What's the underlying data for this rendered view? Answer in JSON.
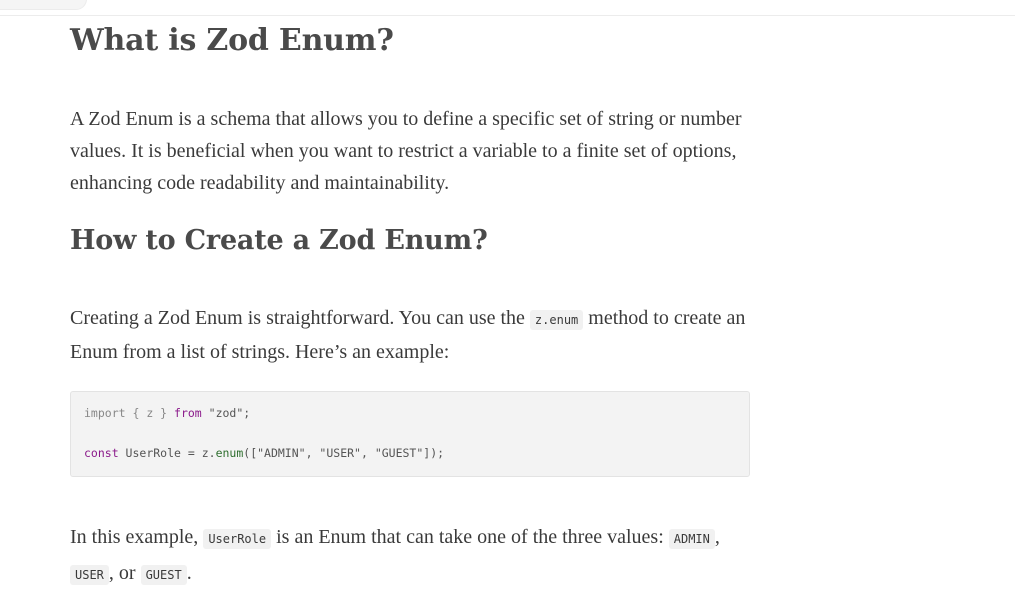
{
  "article": {
    "h_what": "What is Zod Enum?",
    "p1": "A Zod Enum is a schema that allows you to define a specific set of string or number values. It is beneficial when you want to restrict a variable to a finite set of options, enhancing code readability and maintainability.",
    "h_how": "How to Create a Zod Enum?",
    "p2_before": "Creating a Zod Enum is straightforward. You can use the ",
    "p2_code": "z.enum",
    "p2_after": " method to create an Enum from a list of strings. Here’s an example:",
    "code": {
      "l1_kw1": "import",
      "l1_p1": " { z } ",
      "l1_kw2": "from",
      "l1_str": " \"zod\";",
      "l2_kw": "const",
      "l2_ident": " UserRole = z.",
      "l2_fn": "enum",
      "l2_args": "([\"ADMIN\", \"USER\", \"GUEST\"]);"
    },
    "p3_before": "In this example, ",
    "p3_code": "UserRole",
    "p3_mid": " is an Enum that can take one of the three values: ",
    "p3_v1": "ADMIN",
    "p3_sep1": ", ",
    "p3_v2": "USER",
    "p3_sep2": ", or ",
    "p3_v3": "GUEST",
    "p3_end": "."
  }
}
